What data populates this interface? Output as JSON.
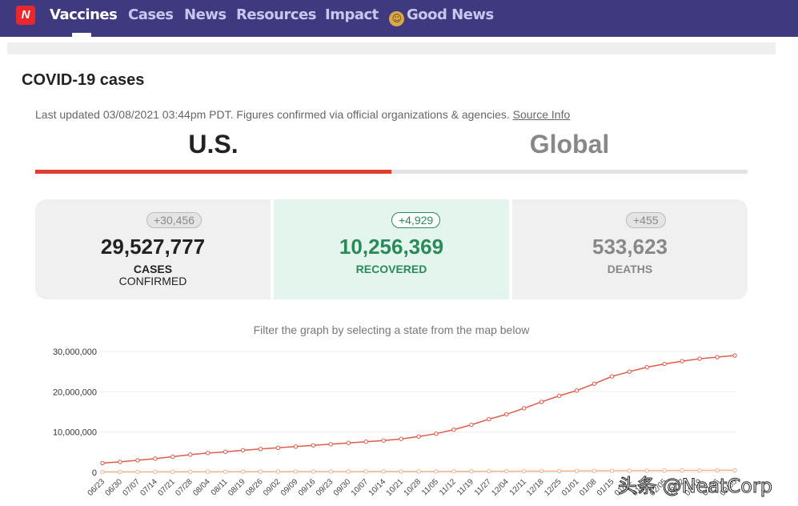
{
  "nav": {
    "logo": "N",
    "items": [
      "Vaccines",
      "Cases",
      "News",
      "Resources",
      "Impact",
      "Good News"
    ],
    "active": "Vaccines"
  },
  "page": {
    "title": "COVID-19 cases",
    "updated": "Last updated 03/08/2021 03:44pm PDT. Figures confirmed via official organizations & agencies.",
    "source_link": "Source Info",
    "tabs": [
      "U.S.",
      "Global"
    ],
    "active_tab": "U.S."
  },
  "stats": {
    "cases": {
      "delta": "+30,456",
      "value": "29,527,777",
      "label1": "CASES",
      "label2": "CONFIRMED",
      "color": "#222222"
    },
    "recovered": {
      "delta": "+4,929",
      "value": "10,256,369",
      "label1": "RECOVERED",
      "color": "#2a8a5a"
    },
    "deaths": {
      "delta": "+455",
      "value": "533,623",
      "label1": "DEATHS",
      "color": "#888888"
    }
  },
  "chart_note": "Filter the graph by selecting a state from the map below",
  "chart_data": {
    "type": "line",
    "grid": true,
    "ylim": [
      0,
      30000000
    ],
    "yticks": [
      "0",
      "10,000,000",
      "20,000,000",
      "30,000,000"
    ],
    "x": [
      "06/23",
      "06/30",
      "07/07",
      "07/14",
      "07/21",
      "07/28",
      "08/04",
      "08/11",
      "08/19",
      "08/26",
      "09/02",
      "09/09",
      "09/16",
      "09/23",
      "09/30",
      "10/07",
      "10/14",
      "10/21",
      "10/28",
      "11/05",
      "11/12",
      "11/19",
      "11/27",
      "12/04",
      "12/11",
      "12/18",
      "12/25",
      "01/01",
      "01/08",
      "01/15",
      "01/22",
      "01/29",
      "02/05",
      "02/12",
      "02/19",
      "02/26",
      "03/05"
    ],
    "series": [
      {
        "color": "#e05a4a",
        "values": [
          2300000,
          2600000,
          3000000,
          3400000,
          3900000,
          4400000,
          4800000,
          5100000,
          5500000,
          5800000,
          6100000,
          6400000,
          6700000,
          7000000,
          7300000,
          7600000,
          7900000,
          8300000,
          8900000,
          9600000,
          10600000,
          11800000,
          13200000,
          14400000,
          15900000,
          17500000,
          19000000,
          20300000,
          22000000,
          23800000,
          25000000,
          26100000,
          26900000,
          27600000,
          28200000,
          28600000,
          29000000
        ]
      },
      {
        "color": "#f0b48f",
        "values": [
          120000,
          125000,
          130000,
          135000,
          140000,
          150000,
          155000,
          160000,
          170000,
          180000,
          185000,
          190000,
          195000,
          200000,
          205000,
          210000,
          215000,
          220000,
          225000,
          235000,
          245000,
          255000,
          265000,
          280000,
          295000,
          310000,
          330000,
          350000,
          370000,
          390000,
          410000,
          430000,
          450000,
          470000,
          490000,
          510000,
          525000
        ]
      }
    ]
  },
  "watermark": "头条 @NeatCorp"
}
